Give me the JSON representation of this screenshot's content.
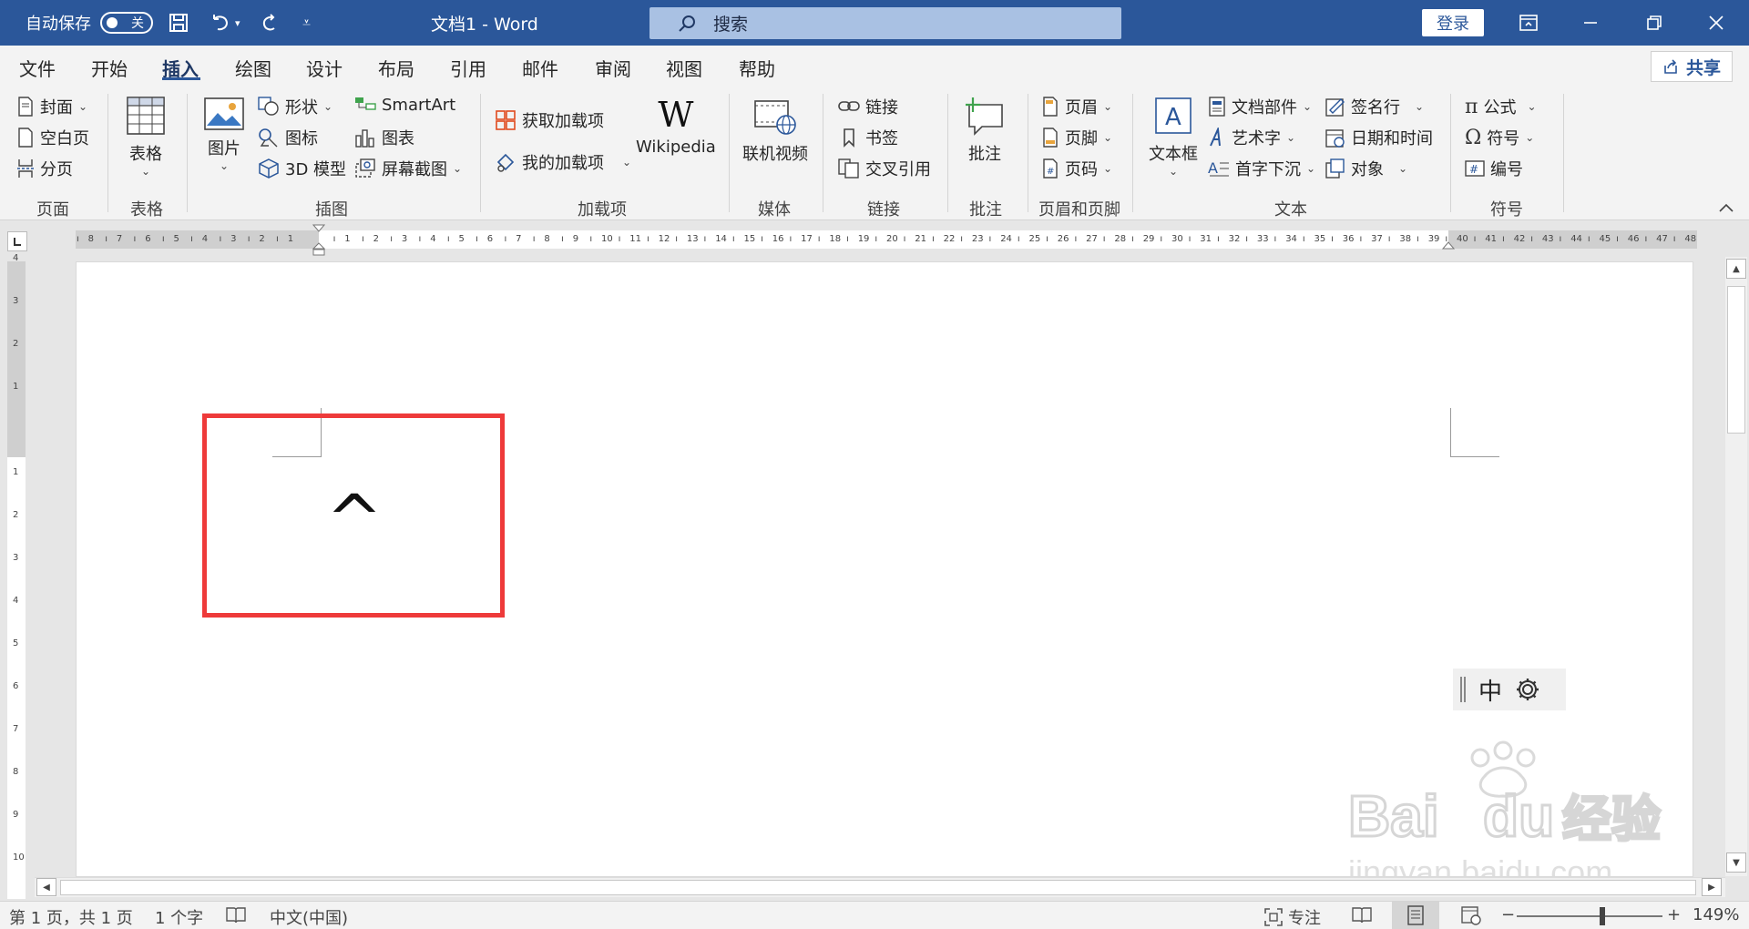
{
  "titlebar": {
    "autosave_label": "自动保存",
    "autosave_state": "关",
    "doc_title": "文档1  -  Word",
    "search_placeholder": "搜索",
    "login_label": "登录",
    "accent_color": "#2b579a"
  },
  "tabs": [
    "文件",
    "开始",
    "插入",
    "绘图",
    "设计",
    "布局",
    "引用",
    "邮件",
    "审阅",
    "视图",
    "帮助"
  ],
  "active_tab": "插入",
  "share_label": "共享",
  "ribbon": {
    "pages": {
      "cover": "封面",
      "blank": "空白页",
      "break": "分页",
      "group": "页面"
    },
    "tables": {
      "table": "表格",
      "group": "表格"
    },
    "illustrations": {
      "picture": "图片",
      "shapes": "形状",
      "icons": "图标",
      "model3d": "3D 模型",
      "smartart": "SmartArt",
      "chart": "图表",
      "screenshot": "屏幕截图",
      "group": "插图"
    },
    "addins": {
      "get": "获取加载项",
      "my": "我的加载项",
      "wiki": "Wikipedia",
      "group": "加载项"
    },
    "media": {
      "video": "联机视频",
      "group": "媒体"
    },
    "links": {
      "link": "链接",
      "bookmark": "书签",
      "xref": "交叉引用",
      "group": "链接"
    },
    "comments": {
      "comment": "批注",
      "group": "批注"
    },
    "headerfooter": {
      "header": "页眉",
      "footer": "页脚",
      "pagenum": "页码",
      "group": "页眉和页脚"
    },
    "text": {
      "textbox": "文本框",
      "parts": "文档部件",
      "wordart": "艺术字",
      "dropcap": "首字下沉",
      "signature": "签名行",
      "datetime": "日期和时间",
      "object": "对象",
      "group": "文本"
    },
    "symbols": {
      "equation": "公式",
      "symbol": "符号",
      "number": "编号",
      "group": "符号"
    }
  },
  "document": {
    "content_char": "^",
    "highlight_color": "#ee3a3a"
  },
  "ime": {
    "mode": "中"
  },
  "watermark": {
    "text": "Baidu经验",
    "url_text": "jingyan.baidu.com"
  },
  "statusbar": {
    "page": "第 1 页，共 1 页",
    "words": "1 个字",
    "language": "中文(中国)",
    "focus": "专注",
    "zoom": "149%",
    "zoom_minus": "−",
    "zoom_plus": "+"
  }
}
